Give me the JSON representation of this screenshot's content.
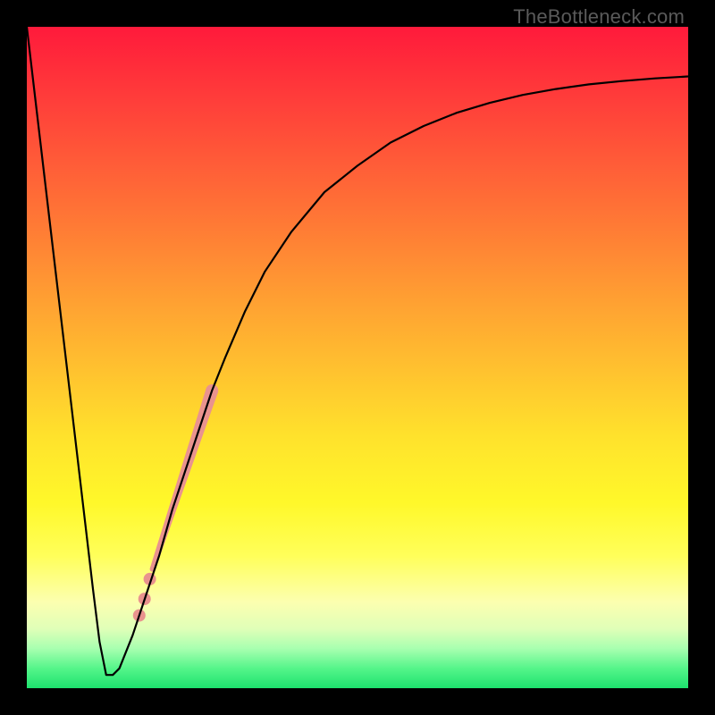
{
  "watermark": "TheBottleneck.com",
  "chart_data": {
    "type": "line",
    "title": "",
    "xlabel": "",
    "ylabel": "",
    "xlim": [
      0,
      100
    ],
    "ylim": [
      0,
      100
    ],
    "grid": false,
    "legend": false,
    "series": [
      {
        "name": "bottleneck-curve",
        "color": "#000000",
        "x": [
          0,
          2,
          4,
          6,
          8,
          10,
          11,
          12,
          13,
          14,
          16,
          18,
          20,
          22,
          24,
          26,
          28,
          30,
          33,
          36,
          40,
          45,
          50,
          55,
          60,
          65,
          70,
          75,
          80,
          85,
          90,
          95,
          100
        ],
        "y": [
          100,
          83,
          66,
          49,
          32,
          15,
          7,
          2,
          2,
          3,
          8,
          14,
          20,
          27,
          33,
          39,
          45,
          50,
          57,
          63,
          69,
          75,
          79,
          82.5,
          85,
          87,
          88.5,
          89.7,
          90.6,
          91.3,
          91.8,
          92.2,
          92.5
        ]
      }
    ],
    "highlight_segment": {
      "name": "salmon-band",
      "color": "#e9938e",
      "x": [
        19,
        20,
        21,
        22,
        23,
        24,
        25,
        26,
        27,
        28
      ],
      "y": [
        18,
        21,
        24,
        27,
        30,
        33,
        36,
        39,
        42,
        45
      ],
      "width_start": 6,
      "width_end": 14
    },
    "highlight_dots": {
      "name": "salmon-dots",
      "color": "#e9938e",
      "points": [
        {
          "x": 17.0,
          "y": 11.0,
          "r": 7
        },
        {
          "x": 17.8,
          "y": 13.5,
          "r": 7
        },
        {
          "x": 18.6,
          "y": 16.5,
          "r": 7
        }
      ]
    },
    "gradient_stops": [
      {
        "pos": 0,
        "color": "#ff1a3b"
      },
      {
        "pos": 10,
        "color": "#ff3a3a"
      },
      {
        "pos": 20,
        "color": "#ff5a38"
      },
      {
        "pos": 30,
        "color": "#ff7a35"
      },
      {
        "pos": 42,
        "color": "#ffa232"
      },
      {
        "pos": 52,
        "color": "#ffc22f"
      },
      {
        "pos": 62,
        "color": "#ffe22c"
      },
      {
        "pos": 72,
        "color": "#fff82a"
      },
      {
        "pos": 80,
        "color": "#ffff5a"
      },
      {
        "pos": 87,
        "color": "#fcffb0"
      },
      {
        "pos": 91,
        "color": "#e0ffb8"
      },
      {
        "pos": 94,
        "color": "#a8ffb0"
      },
      {
        "pos": 97,
        "color": "#55f58a"
      },
      {
        "pos": 100,
        "color": "#1de26e"
      }
    ]
  }
}
